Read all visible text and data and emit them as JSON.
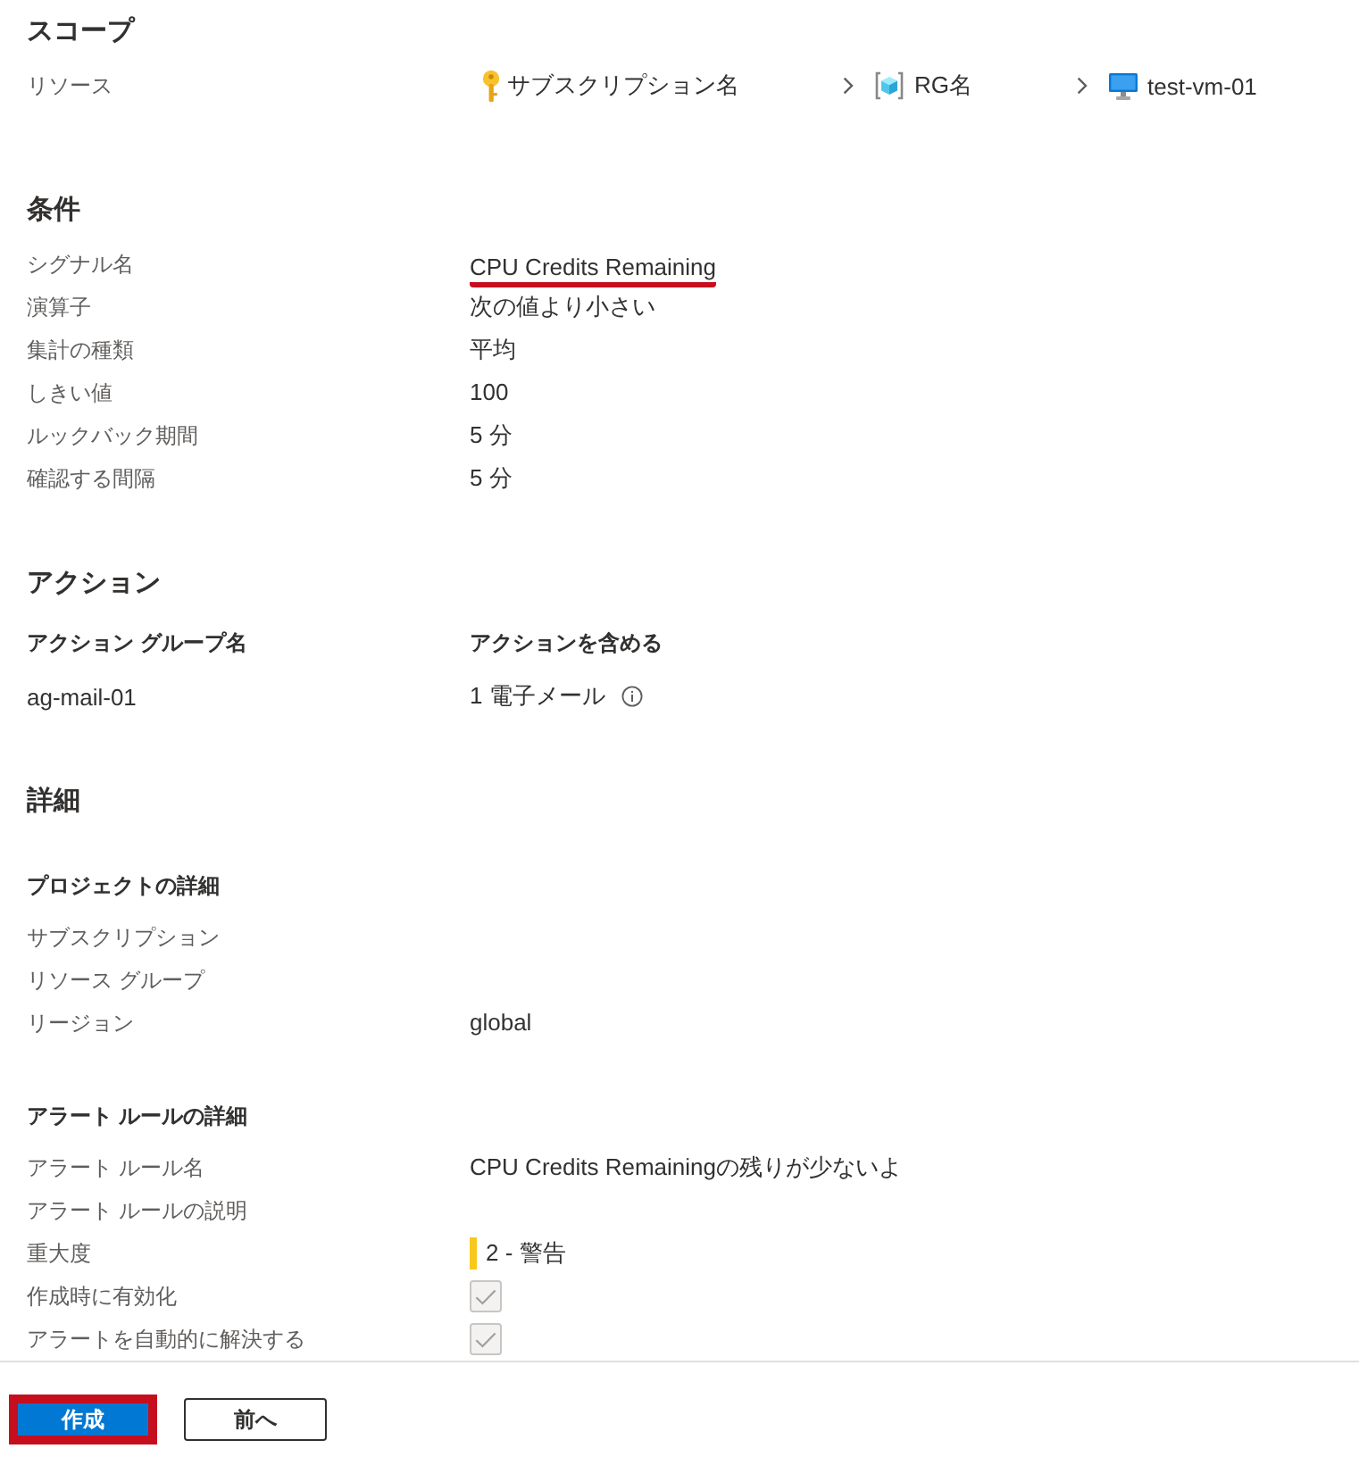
{
  "scope": {
    "title": "スコープ",
    "resource": {
      "label": "リソース",
      "path": [
        {
          "kind": "subscription",
          "text": "サブスクリプション名"
        },
        {
          "kind": "resource-group",
          "text": "RG名"
        },
        {
          "kind": "vm",
          "text": "test-vm-01"
        }
      ]
    }
  },
  "condition": {
    "title": "条件",
    "rows": [
      {
        "label": "シグナル名",
        "value": "CPU Credits Remaining",
        "highlighted": true
      },
      {
        "label": "演算子",
        "value": "次の値より小さい",
        "highlighted": false
      },
      {
        "label": "集計の種類",
        "value": "平均",
        "highlighted": false
      },
      {
        "label": "しきい値",
        "value": "100",
        "highlighted": false
      },
      {
        "label": "ルックバック期間",
        "value": "5 分",
        "highlighted": false
      },
      {
        "label": "確認する間隔",
        "value": "5 分",
        "highlighted": false
      }
    ]
  },
  "actions": {
    "title": "アクション",
    "columns": [
      "アクション グループ名",
      "アクションを含める"
    ],
    "rows": [
      {
        "cells": [
          "ag-mail-01",
          "1 電子メール"
        ],
        "info": true
      }
    ]
  },
  "details": {
    "title": "詳細",
    "groups": [
      {
        "title": "プロジェクトの詳細",
        "rows": [
          {
            "kind": "text",
            "label": "サブスクリプション"
          },
          {
            "kind": "text",
            "label": "リソース グループ"
          },
          {
            "kind": "text",
            "label": "リージョン",
            "value": "global"
          }
        ]
      },
      {
        "title": "アラート ルールの詳細",
        "rows": [
          {
            "kind": "text",
            "label": "アラート ルール名",
            "value": "CPU Credits Remainingの残りが少ないよ"
          },
          {
            "kind": "text",
            "label": "アラート ルールの説明"
          },
          {
            "kind": "severity",
            "label": "重大度",
            "value": "2 - 警告",
            "color": "#f8c81c"
          },
          {
            "kind": "checkbox",
            "label": "作成時に有効化",
            "checked": true,
            "disabled": true
          },
          {
            "kind": "checkbox",
            "label": "アラートを自動的に解決する",
            "checked": true,
            "disabled": true
          }
        ]
      }
    ]
  },
  "footer": {
    "buttons": [
      {
        "label": "作成",
        "kind": "primary",
        "highlighted": true
      },
      {
        "label": "前へ",
        "kind": "secondary",
        "highlighted": false
      }
    ]
  }
}
